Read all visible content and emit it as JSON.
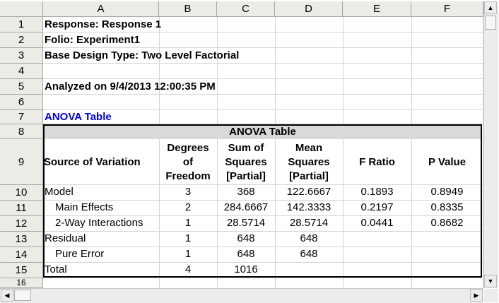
{
  "columns": [
    "A",
    "B",
    "C",
    "D",
    "E",
    "F"
  ],
  "rows": [
    "1",
    "2",
    "3",
    "4",
    "5",
    "6",
    "7",
    "8",
    "9",
    "10",
    "11",
    "12",
    "13",
    "14",
    "15",
    "16"
  ],
  "sheet": {
    "response": "Response: Response 1",
    "folio": "Folio: Experiment1",
    "design_type": "Base Design Type: Two Level Factorial",
    "analyzed": "Analyzed on 9/4/2013 12:00:35 PM",
    "anova_link": "ANOVA Table"
  },
  "anova": {
    "title": "ANOVA Table",
    "headers": {
      "source": "Source of Variation",
      "df": [
        "Degrees",
        "of",
        "Freedom"
      ],
      "ss": [
        "Sum of",
        "Squares",
        "[Partial]"
      ],
      "ms": [
        "Mean",
        "Squares",
        "[Partial]"
      ],
      "f": "F Ratio",
      "p": "P Value"
    },
    "rows": [
      {
        "source": "Model",
        "df": "3",
        "ss": "368",
        "ms": "122.6667",
        "f": "0.1893",
        "p": "0.8949"
      },
      {
        "source": "Main Effects",
        "df": "2",
        "ss": "284.6667",
        "ms": "142.3333",
        "f": "0.2197",
        "p": "0.8335"
      },
      {
        "source": "2-Way Interactions",
        "df": "1",
        "ss": "28.5714",
        "ms": "28.5714",
        "f": "0.0441",
        "p": "0.8682"
      },
      {
        "source": "Residual",
        "df": "1",
        "ss": "648",
        "ms": "648",
        "f": "",
        "p": ""
      },
      {
        "source": "Pure Error",
        "df": "1",
        "ss": "648",
        "ms": "648",
        "f": "",
        "p": ""
      },
      {
        "source": "Total",
        "df": "4",
        "ss": "1016",
        "ms": "",
        "f": "",
        "p": ""
      }
    ]
  },
  "icons": {
    "scroll_up": "▲",
    "scroll_down": "▼",
    "scroll_left": "◀",
    "scroll_right": "▶"
  }
}
